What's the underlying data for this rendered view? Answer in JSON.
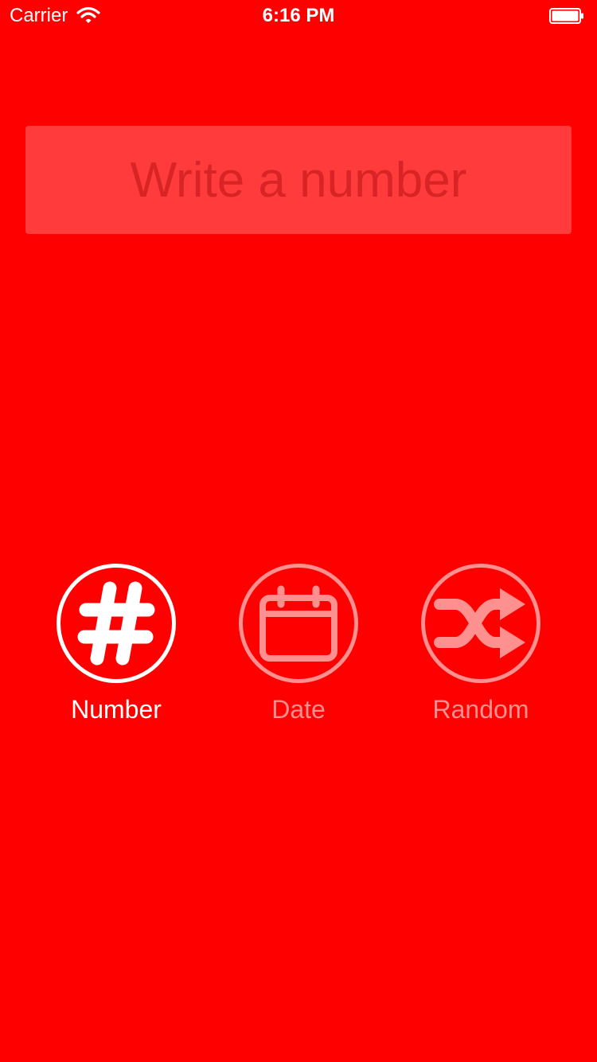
{
  "status_bar": {
    "carrier": "Carrier",
    "time": "6:16 PM",
    "wifi_icon": "wifi-icon",
    "battery_icon": "battery-icon"
  },
  "input": {
    "placeholder": "Write a number",
    "value": ""
  },
  "modes": {
    "selected": "number",
    "items": [
      {
        "id": "number",
        "label": "Number",
        "icon": "hash-icon"
      },
      {
        "id": "date",
        "label": "Date",
        "icon": "calendar-icon"
      },
      {
        "id": "random",
        "label": "Random",
        "icon": "shuffle-icon"
      }
    ]
  },
  "colors": {
    "background": "#ff0000",
    "input_background": "#ff3b3b",
    "placeholder": "#d82424",
    "active": "#ffffff",
    "inactive": "#ff9090"
  }
}
